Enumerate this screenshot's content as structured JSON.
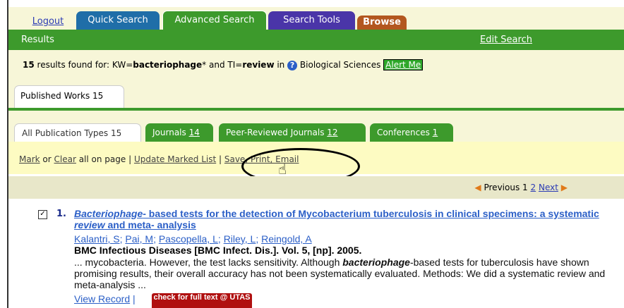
{
  "nav": {
    "logout": "Logout",
    "quick_search": "Quick Search",
    "advanced_search": "Advanced Search",
    "search_tools": "Search Tools",
    "browse": "Browse"
  },
  "results_bar": {
    "title": "Results",
    "edit_search": "Edit Search"
  },
  "summary": {
    "count": "15",
    "found_for": " results found for: KW=",
    "kw": "bacteriophage",
    "and_ti": "* and TI=",
    "ti": "review",
    "in": " in ",
    "db": " Biological Sciences ",
    "alert": "Alert Me"
  },
  "published_tab": "Published Works 15",
  "filters": {
    "all": "All Publication Types 15",
    "journals_label": "Journals ",
    "journals_count": "14",
    "peer_label": "Peer-Reviewed Journals ",
    "peer_count": "12",
    "conf_label": "Conferences ",
    "conf_count": "1"
  },
  "mark_bar": {
    "mark": "Mark",
    "or": " or ",
    "clear": "Clear",
    "all_on_page": " all on page | ",
    "update": "Update Marked List",
    "sep": " | ",
    "save": "Save, Print, Email"
  },
  "pager": {
    "previous": "Previous",
    "page1": "1",
    "page2": "2",
    "next": "Next"
  },
  "record": {
    "number": "1.",
    "title_a": "Bacteriophage",
    "title_b": "- based tests for the detection of Mycobacterium tuberculosis in clinical specimens: a systematic ",
    "title_c": "review",
    "title_d": " and meta- analysis",
    "authors": [
      "Kalantri, S",
      "Pai, M",
      "Pascopella, L",
      "Riley, L",
      "Reingold, A"
    ],
    "source": "BMC Infectious Diseases [BMC Infect. Dis.]. Vol. 5, [np]. 2005.",
    "abstract_a": "... mycobacteria. However, the test lacks sensitivity. Although ",
    "abstract_b": "bacteriophage",
    "abstract_c": "-based tests for tuberculosis have shown promising results, their overall accuracy has not been systematically evaluated. Methods: We did a systematic review and meta-analysis ...",
    "view_record": "View Record",
    "view_sep": " |",
    "fulltext": "check for full text @ UTAS"
  }
}
